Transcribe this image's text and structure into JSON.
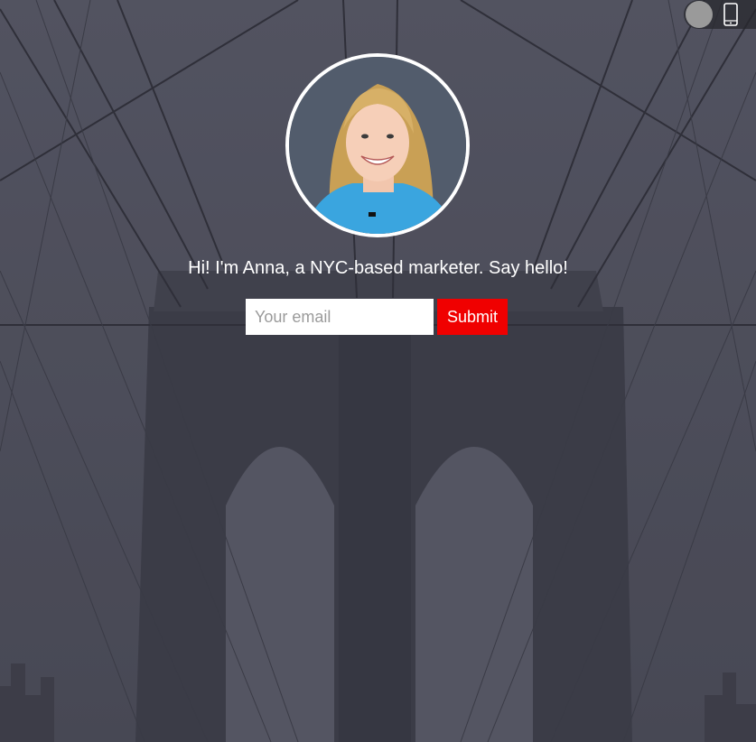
{
  "background": {
    "description_icon": "brooklyn-bridge-background",
    "tint_color": "#4a4b58"
  },
  "toggle": {
    "knob_icon": "toggle-knob-icon",
    "device_icon": "mobile-phone-icon"
  },
  "profile": {
    "avatar_icon": "avatar-photo",
    "headline": "Hi! I'm Anna, a NYC-based marketer. Say hello!"
  },
  "form": {
    "email_placeholder": "Your email",
    "email_value": "",
    "submit_label": "Submit",
    "submit_color": "#f00000"
  }
}
